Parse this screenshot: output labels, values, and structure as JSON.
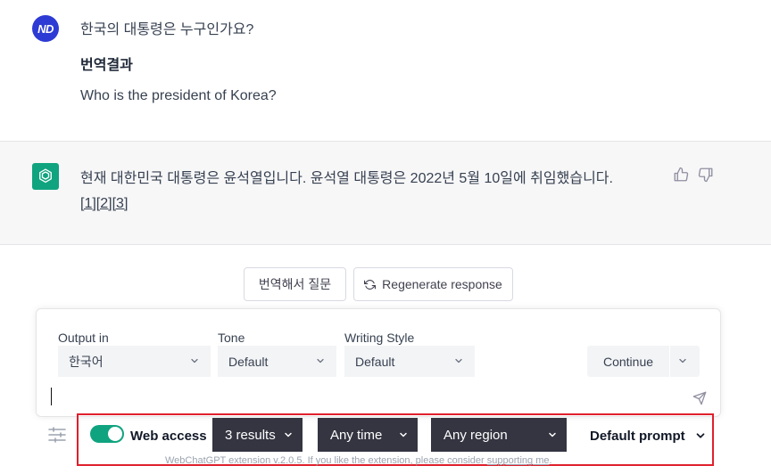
{
  "user_message": {
    "avatar_text": "ND",
    "question": "한국의 대통령은 누구인가요?",
    "translation_title": "번역결과",
    "translation_text": "Who is the president of Korea?"
  },
  "assistant_message": {
    "text": "현재 대한민국 대통령은 윤석열입니다. 윤석열 대통령은 2022년 5월 10일에 취임했습니다.",
    "citations": [
      "[1]",
      "[2]",
      "[3]"
    ]
  },
  "actions": {
    "translate_ask_label": "번역해서 질문",
    "regenerate_label": "Regenerate response"
  },
  "prompt_panel": {
    "output_in_label": "Output in",
    "output_in_value": "한국어",
    "tone_label": "Tone",
    "tone_value": "Default",
    "writing_style_label": "Writing Style",
    "writing_style_value": "Default",
    "continue_label": "Continue",
    "input_value": ""
  },
  "webchatgpt": {
    "web_access_label": "Web access",
    "web_access_on": true,
    "results_value": "3 results",
    "time_value": "Any time",
    "region_value": "Any region",
    "prompt_value": "Default prompt",
    "footer_text": "WebChatGPT extension v.2.0.5. If you like the extension, please consider ",
    "footer_link": "supporting me",
    "footer_end": "."
  },
  "colors": {
    "accent_green": "#10a37f",
    "avatar_blue": "#2d3bd4",
    "highlight_red": "#e0202c",
    "dark_select": "#343541"
  }
}
